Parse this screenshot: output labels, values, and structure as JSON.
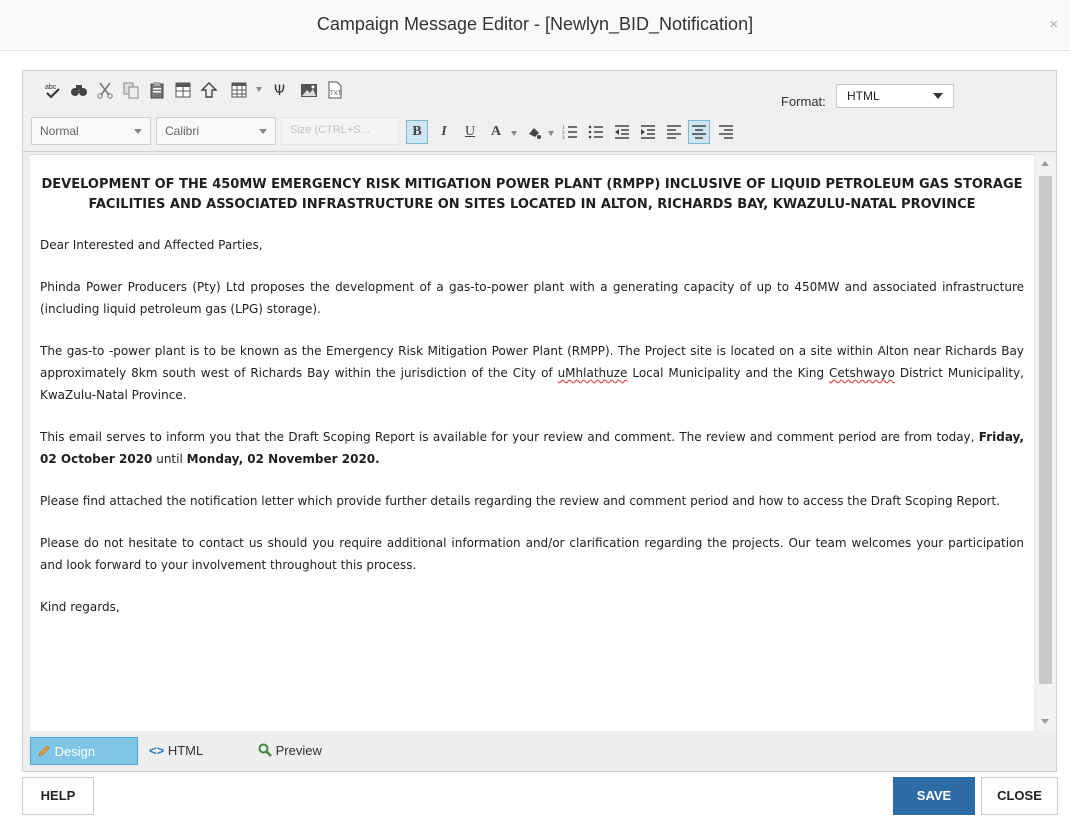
{
  "dialog": {
    "title": "Campaign Message Editor - [Newlyn_BID_Notification]",
    "close_glyph": "×"
  },
  "toolbar": {
    "icons": [
      "spell-check-icon",
      "find-icon",
      "cut-icon",
      "copy-icon",
      "paste-icon",
      "insert-table-icon",
      "insert-link-icon",
      "table-grid-icon",
      "special-chars-icon",
      "image-manager-icon",
      "document-manager-icon"
    ],
    "format_label": "Format:",
    "format_value": "HTML",
    "paragraph_style": "Normal",
    "font_name": "Calibri",
    "font_size_placeholder": "Size (CTRL+S..."
  },
  "formatting": {
    "bold": "B",
    "italic": "I",
    "underline": "U",
    "font_color": "A"
  },
  "document": {
    "heading": "DEVELOPMENT OF THE 450MW EMERGENCY RISK MITIGATION POWER PLANT (RMPP) INCLUSIVE OF LIQUID PETROLEUM GAS STORAGE FACILITIES AND ASSOCIATED INFRASTRUCTURE ON SITES LOCATED IN ALTON, RICHARDS BAY, KWAZULU-NATAL PROVINCE",
    "greeting": "Dear Interested and Affected Parties,",
    "p1": "Phinda Power Producers (Pty) Ltd proposes the development of a gas-to-power plant with a generating capacity of up to 450MW and associated infrastructure (including liquid petroleum gas (LPG) storage).",
    "p2_a": "The gas-to -power plant is to be known as the Emergency Risk Mitigation Power Plant (RMPP). The Project site is located on a site within Alton near Richards Bay approximately 8km south west of Richards Bay within the jurisdiction of the City of ",
    "p2_b": "uMhlathuze",
    "p2_c": " Local Municipality and the King ",
    "p2_d": "Cetshwayo",
    "p2_e": " District Municipality, KwaZulu-Natal Province.",
    "p3_a": "This email serves to inform you that the Draft Scoping Report is available for your review and comment.  The review and comment period are from today, ",
    "p3_b": "Friday, 02 October 2020",
    "p3_c": " until ",
    "p3_d": "Monday, 02 November 2020.",
    "p4": "Please find attached the notification letter which provide further details regarding the review and comment period and how to access the Draft Scoping Report.",
    "p5": "Please do not hesitate to contact us should you require additional information and/or clarification regarding the projects. Our team welcomes your participation and look forward to your involvement throughout this process.",
    "closing": "Kind regards,"
  },
  "modes": {
    "design": "Design",
    "html": "HTML",
    "preview": "Preview"
  },
  "footer": {
    "help": "HELP",
    "save": "SAVE",
    "close": "CLOSE"
  },
  "colors": {
    "accent": "#2e6ca8",
    "active_tab": "#7fc6e6",
    "spellcheck": "#d9534f"
  }
}
